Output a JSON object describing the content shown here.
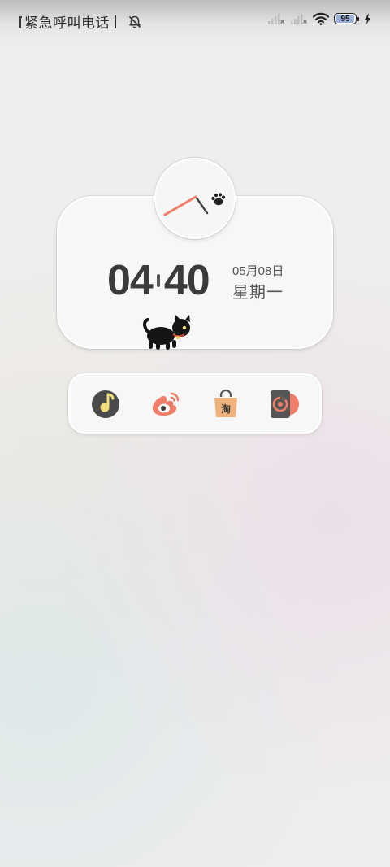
{
  "status_bar": {
    "carrier_text": "紧急呼叫电话",
    "battery_level": 95,
    "battery_text": "95",
    "icons": [
      "bell-muted-icon",
      "signal-no-service-icon",
      "signal-no-service-icon",
      "wifi-icon",
      "battery-icon",
      "charging-bolt-icon"
    ]
  },
  "clock": {
    "hour": "04",
    "minute": "40",
    "date": "05月08日",
    "weekday": "星期一"
  },
  "dock": {
    "apps": [
      {
        "icon": "music-app-icon",
        "color": "#4a4a4a",
        "accent": "#f2df7a"
      },
      {
        "icon": "weibo-app-icon",
        "color": "#ef7d68"
      },
      {
        "icon": "taobao-app-icon",
        "color": "#f0b27a",
        "glyph": "淘"
      },
      {
        "icon": "netease-music-app-icon",
        "color": "#555555",
        "accent": "#ef7d68"
      }
    ]
  },
  "colors": {
    "accent_pink": "#ef7d68",
    "text_dark": "#3b3b3b"
  }
}
